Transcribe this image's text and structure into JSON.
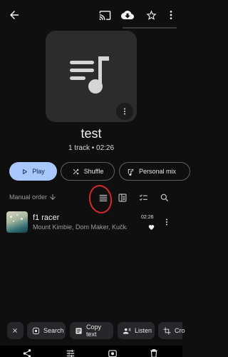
{
  "colors": {
    "background": "#0f0f10",
    "accent": "#a8c7fa",
    "annotation": "#d42a2a"
  },
  "topbar": {
    "icons": [
      "back-arrow-icon",
      "cast-icon",
      "cloud-download-icon",
      "star-icon",
      "more-vert-icon"
    ]
  },
  "playlist": {
    "title": "test",
    "subtitle": "1 track • 02:26"
  },
  "actions": {
    "play": "Play",
    "shuffle": "Shuffle",
    "personal_mix": "Personal mix"
  },
  "sort": {
    "label": "Manual order"
  },
  "tracks": [
    {
      "title": "f1 racer",
      "artist": "Mount Kimbie, Dom Maker, Kučka •",
      "duration": "02:26",
      "liked": true
    }
  ],
  "ocr_bar": {
    "search": "Search",
    "copy_text": "Copy text",
    "listen": "Listen",
    "crop": "Cro"
  }
}
